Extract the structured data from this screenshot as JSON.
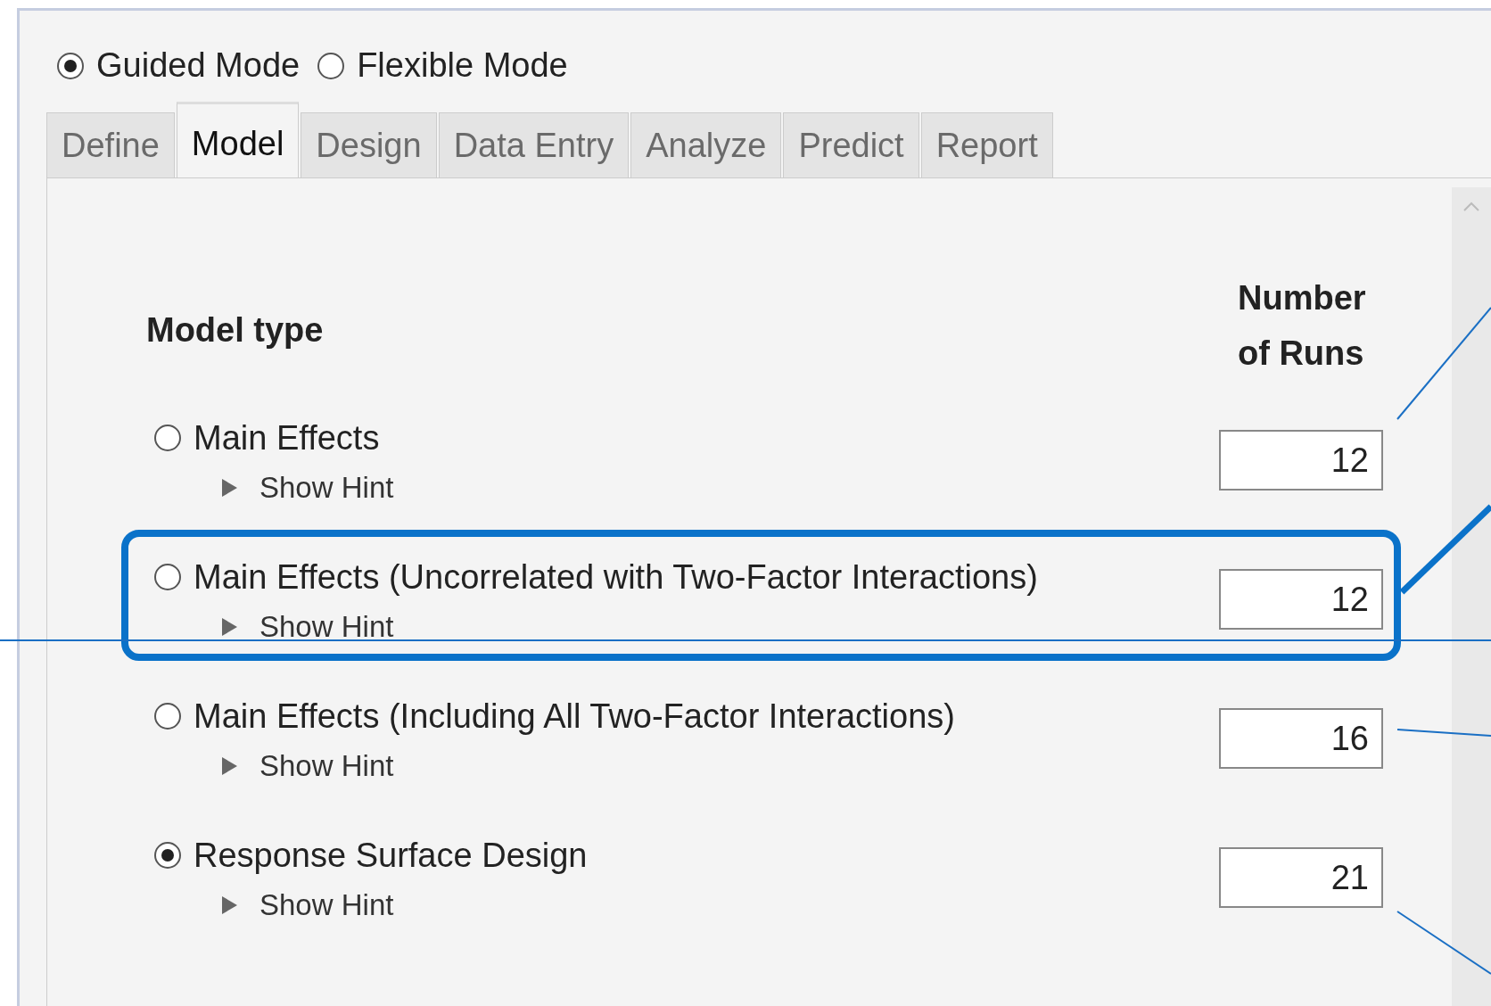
{
  "mode_options": [
    {
      "label": "Guided Mode",
      "selected": true
    },
    {
      "label": "Flexible Mode",
      "selected": false
    }
  ],
  "tabs": [
    {
      "label": "Define",
      "selected": false
    },
    {
      "label": "Model",
      "selected": true
    },
    {
      "label": "Design",
      "selected": false
    },
    {
      "label": "Data Entry",
      "selected": false
    },
    {
      "label": "Analyze",
      "selected": false
    },
    {
      "label": "Predict",
      "selected": false
    },
    {
      "label": "Report",
      "selected": false
    }
  ],
  "model_type_heading": "Model type",
  "runs_heading": "Number of Runs",
  "models": [
    {
      "label": "Main Effects",
      "hint": "Show Hint",
      "expanded": false,
      "runs": "12",
      "selected": false,
      "highlighted": false
    },
    {
      "label": "Main Effects (Uncorrelated with Two-Factor Interactions)",
      "hint": "Show Hint",
      "expanded": false,
      "runs": "12",
      "selected": false,
      "highlighted": true
    },
    {
      "label": "Main Effects (Including All Two-Factor Interactions)",
      "hint": "Show Hint",
      "expanded": false,
      "runs": "16",
      "selected": false,
      "highlighted": false
    },
    {
      "label": "Response Surface Design",
      "hint": "Show Hint",
      "expanded": false,
      "runs": "21",
      "selected": true,
      "highlighted": false
    }
  ]
}
